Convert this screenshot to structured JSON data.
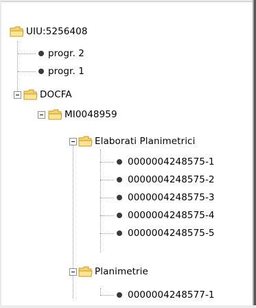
{
  "tree": {
    "root": {
      "label": "UIU:5256408"
    },
    "progr2": {
      "label": "progr. 2"
    },
    "progr1": {
      "label": "progr. 1"
    },
    "docfa": {
      "label": "DOCFA"
    },
    "mi": {
      "label": "MI0048959"
    },
    "elaborati": {
      "label": "Elaborati Planimetrici"
    },
    "elaborati_items": [
      "0000004248575-1",
      "0000004248575-2",
      "0000004248575-3",
      "0000004248575-4",
      "0000004248575-5"
    ],
    "planimetrie": {
      "label": "Planimetrie"
    },
    "planimetrie_items": [
      "0000004248577-1"
    ]
  },
  "colors": {
    "folder_fill": "#f6d36b",
    "folder_edge": "#c9962a",
    "node_dot": "#3a3a3a",
    "connector": "#9b9b9b"
  }
}
